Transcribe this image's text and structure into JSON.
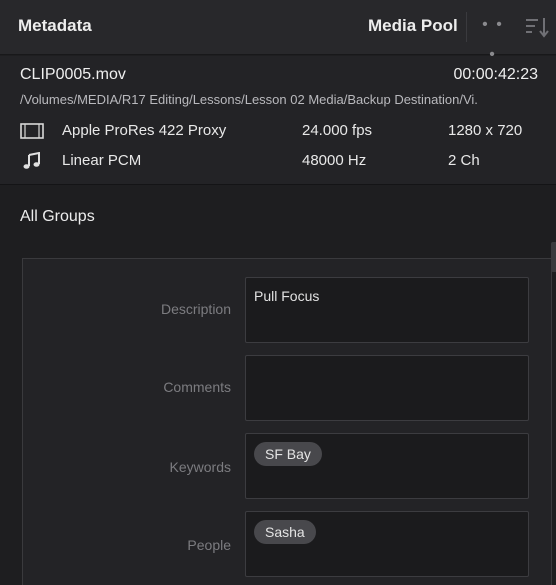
{
  "header": {
    "title": "Metadata",
    "media_pool": "Media Pool",
    "more_icon": "ellipsis-icon",
    "sort_icon": "sort-icon"
  },
  "clip": {
    "name": "CLIP0005.mov",
    "timecode": "00:00:42:23",
    "path": "/Volumes/MEDIA/R17 Editing/Lessons/Lesson 02 Media/Backup Destination/Vi.",
    "video": {
      "icon": "film-icon",
      "codec": "Apple ProRes 422 Proxy",
      "rate": "24.000 fps",
      "resolution": "1280 x 720"
    },
    "audio": {
      "icon": "music-note-icon",
      "codec": "Linear PCM",
      "rate": "48000 Hz",
      "channels": "2 Ch"
    }
  },
  "groups": {
    "label": "All Groups",
    "fields": [
      {
        "label": "Description",
        "value": "Pull Focus"
      },
      {
        "label": "Comments",
        "value": ""
      },
      {
        "label": "Keywords",
        "tag": "SF Bay"
      },
      {
        "label": "People",
        "tag": "Sasha"
      }
    ]
  },
  "colors": {
    "background": "#1e1e20",
    "header": "#28282b",
    "text": "#e6e6e6",
    "muted_label": "#7c7c80",
    "tag": "#48484c"
  }
}
